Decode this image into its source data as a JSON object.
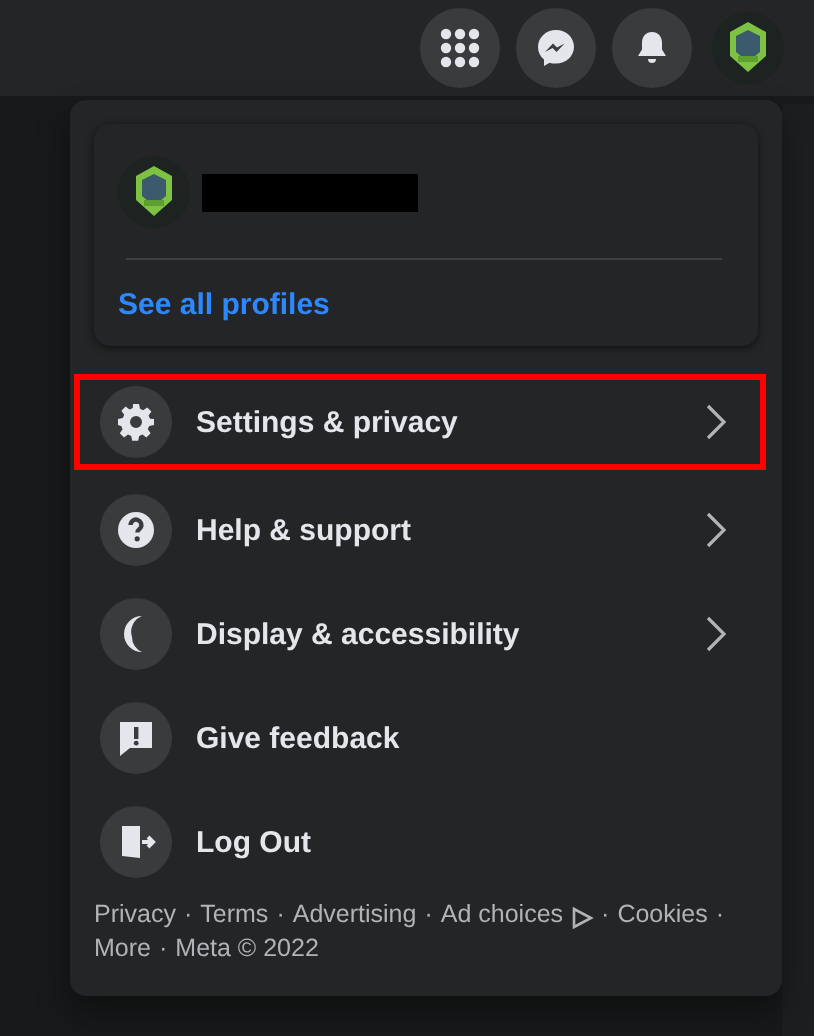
{
  "top_bar": {
    "buttons": [
      {
        "kind": "grid"
      },
      {
        "kind": "messenger"
      },
      {
        "kind": "bell"
      },
      {
        "kind": "avatar"
      }
    ]
  },
  "profile_card": {
    "link": "See all profiles"
  },
  "menu": {
    "items": [
      {
        "label": "Settings & privacy",
        "kind": "gear",
        "has_submenu": true,
        "highlighted": true
      },
      {
        "label": "Help & support",
        "kind": "help",
        "has_submenu": true,
        "highlighted": false
      },
      {
        "label": "Display & accessibility",
        "kind": "moon",
        "has_submenu": true,
        "highlighted": false
      },
      {
        "label": "Give feedback",
        "kind": "feedback",
        "has_submenu": false,
        "highlighted": false
      },
      {
        "label": "Log Out",
        "kind": "logout",
        "has_submenu": false,
        "highlighted": false
      }
    ]
  },
  "footer": {
    "links": [
      "Privacy",
      "Terms",
      "Advertising",
      "Ad choices",
      "Cookies",
      "More"
    ],
    "copyright": "Meta © 2022",
    "separator": "·"
  }
}
